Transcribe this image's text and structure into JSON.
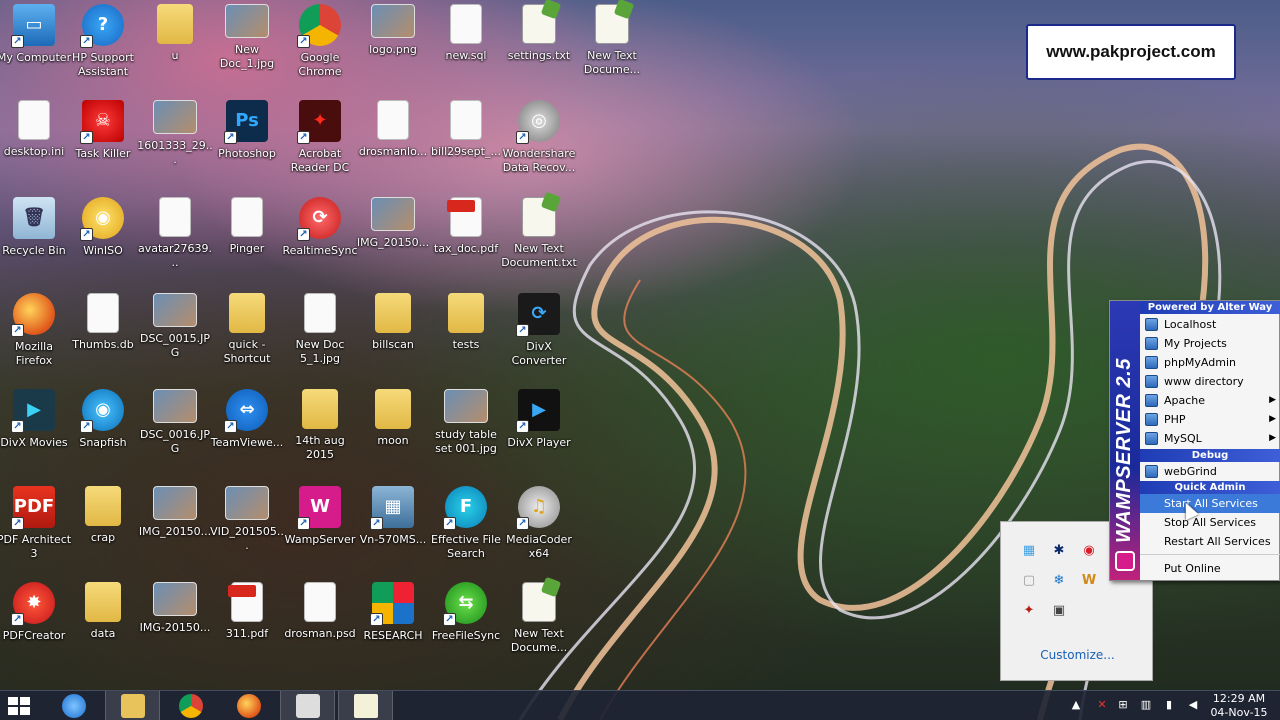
{
  "desktop": {
    "icons": [
      {
        "label": "My Computer",
        "kind": "computer",
        "col": 0,
        "row": 0
      },
      {
        "label": "HP Support Assistant",
        "kind": "help",
        "col": 1,
        "row": 0
      },
      {
        "label": "u",
        "kind": "folder",
        "col": 2,
        "row": 0
      },
      {
        "label": "New Doc_1.jpg",
        "kind": "photo",
        "col": 3,
        "row": 0
      },
      {
        "label": "Google Chrome",
        "kind": "chrome",
        "col": 4,
        "row": 0
      },
      {
        "label": "logo.png",
        "kind": "photo",
        "col": 5,
        "row": 0
      },
      {
        "label": "new.sql",
        "kind": "file",
        "col": 6,
        "row": 0
      },
      {
        "label": "settings.txt",
        "kind": "txt",
        "col": 7,
        "row": 0
      },
      {
        "label": "New Text Docume...",
        "kind": "txt",
        "col": 8,
        "row": 0
      },
      {
        "label": "desktop.ini",
        "kind": "file",
        "col": 0,
        "row": 1
      },
      {
        "label": "Task Killer",
        "kind": "killer",
        "col": 1,
        "row": 1
      },
      {
        "label": "1601333_29...",
        "kind": "photo",
        "col": 2,
        "row": 1
      },
      {
        "label": "Photoshop",
        "kind": "ps",
        "col": 3,
        "row": 1
      },
      {
        "label": "Acrobat Reader DC",
        "kind": "acrobat",
        "col": 4,
        "row": 1
      },
      {
        "label": "drosmanlo...",
        "kind": "file",
        "col": 5,
        "row": 1
      },
      {
        "label": "bill29sept_...",
        "kind": "file",
        "col": 6,
        "row": 1
      },
      {
        "label": "Wondershare Data Recov...",
        "kind": "disk",
        "col": 7,
        "row": 1
      },
      {
        "label": "Recycle Bin",
        "kind": "bin",
        "col": 0,
        "row": 2
      },
      {
        "label": "WinISO",
        "kind": "iso",
        "col": 1,
        "row": 2
      },
      {
        "label": "avatar27639...",
        "kind": "file",
        "col": 2,
        "row": 2
      },
      {
        "label": "Pinger",
        "kind": "file",
        "col": 3,
        "row": 2
      },
      {
        "label": "RealtimeSync",
        "kind": "sync",
        "col": 4,
        "row": 2
      },
      {
        "label": "IMG_20150...",
        "kind": "photo",
        "col": 5,
        "row": 2
      },
      {
        "label": "tax_doc.pdf",
        "kind": "pdf",
        "col": 6,
        "row": 2
      },
      {
        "label": "New Text Document.txt",
        "kind": "txt",
        "col": 7,
        "row": 2
      },
      {
        "label": "Mozilla Firefox",
        "kind": "firefox",
        "col": 0,
        "row": 3
      },
      {
        "label": "Thumbs.db",
        "kind": "file",
        "col": 1,
        "row": 3
      },
      {
        "label": "DSC_0015.JPG",
        "kind": "photo",
        "col": 2,
        "row": 3
      },
      {
        "label": "quick - Shortcut",
        "kind": "folder",
        "col": 3,
        "row": 3
      },
      {
        "label": "New Doc 5_1.jpg",
        "kind": "file",
        "col": 4,
        "row": 3
      },
      {
        "label": "billscan",
        "kind": "folder",
        "col": 5,
        "row": 3
      },
      {
        "label": "tests",
        "kind": "folder",
        "col": 6,
        "row": 3
      },
      {
        "label": "DivX Converter",
        "kind": "divx",
        "col": 7,
        "row": 3
      },
      {
        "label": "DivX Movies",
        "kind": "divxm",
        "col": 0,
        "row": 4
      },
      {
        "label": "Snapfish",
        "kind": "snap",
        "col": 1,
        "row": 4
      },
      {
        "label": "DSC_0016.JPG",
        "kind": "photo",
        "col": 2,
        "row": 4
      },
      {
        "label": "TeamViewe...",
        "kind": "teamviewer",
        "col": 3,
        "row": 4
      },
      {
        "label": "14th aug 2015",
        "kind": "folder",
        "col": 4,
        "row": 4
      },
      {
        "label": "moon",
        "kind": "folder",
        "col": 5,
        "row": 4
      },
      {
        "label": "study table set 001.jpg",
        "kind": "photo",
        "col": 6,
        "row": 4
      },
      {
        "label": "DivX Player",
        "kind": "divxp",
        "col": 7,
        "row": 4
      },
      {
        "label": "PDF Architect 3",
        "kind": "pdfa",
        "col": 0,
        "row": 5
      },
      {
        "label": "crap",
        "kind": "folder",
        "col": 1,
        "row": 5
      },
      {
        "label": "IMG_20150...",
        "kind": "photo",
        "col": 2,
        "row": 5
      },
      {
        "label": "VID_201505...",
        "kind": "photo",
        "col": 3,
        "row": 5
      },
      {
        "label": "WampServer",
        "kind": "wamp",
        "col": 4,
        "row": 5
      },
      {
        "label": "Vn-570MS...",
        "kind": "calc",
        "col": 5,
        "row": 5
      },
      {
        "label": "Effective File Search",
        "kind": "efs",
        "col": 6,
        "row": 5
      },
      {
        "label": "MediaCoder x64",
        "kind": "media",
        "col": 7,
        "row": 5
      },
      {
        "label": "PDFCreator",
        "kind": "pdfc",
        "col": 0,
        "row": 6
      },
      {
        "label": "data",
        "kind": "folder",
        "col": 1,
        "row": 6
      },
      {
        "label": "IMG-20150...",
        "kind": "photo",
        "col": 2,
        "row": 6
      },
      {
        "label": "311.pdf",
        "kind": "pdf",
        "col": 3,
        "row": 6
      },
      {
        "label": "drosman.psd",
        "kind": "file",
        "col": 4,
        "row": 6
      },
      {
        "label": "RESEARCH",
        "kind": "shield",
        "col": 5,
        "row": 6
      },
      {
        "label": "FreeFileSync",
        "kind": "ffs",
        "col": 6,
        "row": 6
      },
      {
        "label": "New Text Docume...",
        "kind": "txt",
        "col": 7,
        "row": 6
      }
    ]
  },
  "brand": {
    "text": "www.pakproject.com"
  },
  "wamp_menu": {
    "side_title": "WAMPSERVER 2.5",
    "header_top": "Powered by Alter Way",
    "items": [
      {
        "label": "Localhost",
        "submenu": false
      },
      {
        "label": "My Projects",
        "submenu": false
      },
      {
        "label": "phpMyAdmin",
        "submenu": false
      },
      {
        "label": "www directory",
        "submenu": false
      },
      {
        "label": "Apache",
        "submenu": true
      },
      {
        "label": "PHP",
        "submenu": true
      },
      {
        "label": "MySQL",
        "submenu": true
      }
    ],
    "header_debug": "Debug",
    "debug_items": [
      {
        "label": "webGrind"
      }
    ],
    "header_quick": "Quick Admin",
    "quick_items": [
      {
        "label": "Start All Services",
        "highlighted": true
      },
      {
        "label": "Stop All Services",
        "highlighted": false
      },
      {
        "label": "Restart All Services",
        "highlighted": false
      }
    ],
    "footer_item": "Put Online",
    "accent": "#1f3cb4"
  },
  "tray_overflow": {
    "icons": [
      "network-icon",
      "bluetooth-icon",
      "beats-icon",
      "",
      "drive-icon",
      "snowflake-icon",
      "wamp-tray-icon",
      "",
      "acrobat-icon",
      "window-icon"
    ],
    "customize_label": "Customize..."
  },
  "taskbar": {
    "clock_time": "12:29 AM",
    "clock_date": "04-Nov-15"
  }
}
